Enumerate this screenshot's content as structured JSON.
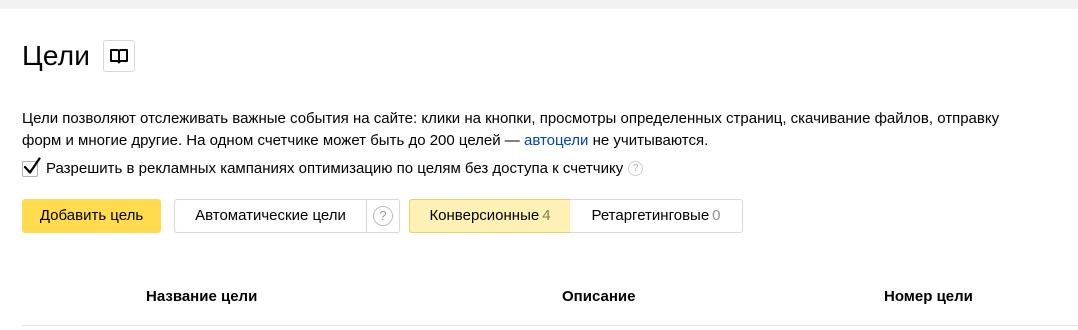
{
  "page": {
    "title": "Цели"
  },
  "intro": {
    "text_before_link": "Цели позволяют отслеживать важные события на сайте: клики на кнопки, просмотры определенных страниц, скачивание файлов, отправку форм и многие другие. На одном счетчике может быть до 200 целей — ",
    "link_text": "автоцели",
    "text_after_link": " не учитываются."
  },
  "checkbox": {
    "label": "Разрешить в рекламных кампаниях оптимизацию по целям без доступа к счетчику",
    "checked": true,
    "help_glyph": "?"
  },
  "actions": {
    "add_goal_label": "Добавить цель",
    "auto_goals_label": "Автоматические цели",
    "auto_goals_help_glyph": "?"
  },
  "tabs": [
    {
      "label": "Конверсионные",
      "count": "4",
      "selected": true
    },
    {
      "label": "Ретаргетинговые",
      "count": "0",
      "selected": false
    }
  ],
  "table": {
    "columns": [
      "Название цели",
      "Описание",
      "Номер цели"
    ]
  },
  "colors": {
    "primary_button": "#ffdb4d",
    "selected_tab": "#fff0b3",
    "link": "#0044bb",
    "background": "#f2f2f2"
  },
  "icons": {
    "docs": "book-icon",
    "check": "checkmark-icon",
    "help": "question-icon"
  }
}
